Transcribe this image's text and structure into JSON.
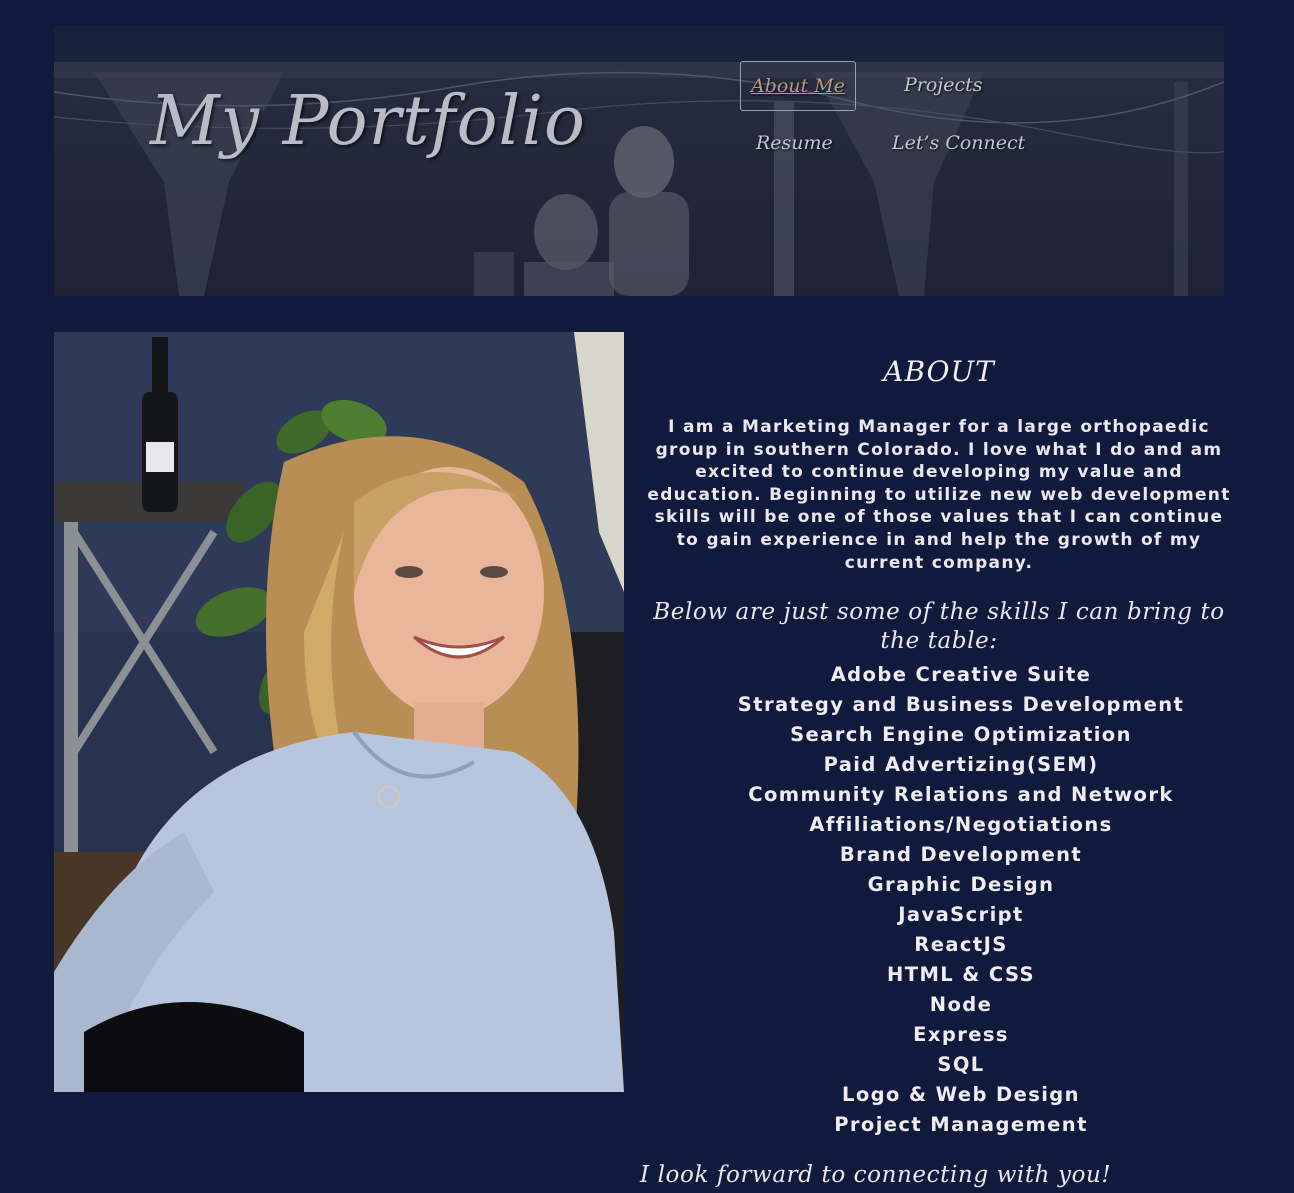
{
  "header": {
    "site_title": "My Portfolio",
    "nav": [
      {
        "label": "About Me",
        "active": true
      },
      {
        "label": "Projects",
        "active": false
      },
      {
        "label": "Resume",
        "active": false
      },
      {
        "label": "Let’s Connect",
        "active": false
      }
    ]
  },
  "about": {
    "heading": "ABOUT",
    "bio": "I am a Marketing Manager for a large orthopaedic group in southern Colorado. I love what I do and am excited to continue developing my value and education. Beginning to utilize new web development skills will be one of those values that I can continue to gain experience in and help the growth of my current company.",
    "skills_intro": "Below are just some of the skills I can bring to the table:",
    "skills": [
      "Adobe Creative Suite",
      "Strategy and Business Development",
      "Search Engine Optimization",
      "Paid Advertizing(SEM)",
      "Community Relations and Network",
      "Affiliations/Negotiations",
      "Brand Development",
      "Graphic Design",
      "JavaScript",
      "ReactJS",
      "HTML & CSS",
      "Node",
      "Express",
      "SQL",
      "Logo & Web Design",
      "Project Management"
    ],
    "closing": "I look forward to connecting with you!"
  },
  "colors": {
    "page_background": "#101a3c",
    "text": "#ebe7ee",
    "active_nav": "#b99a7e"
  }
}
